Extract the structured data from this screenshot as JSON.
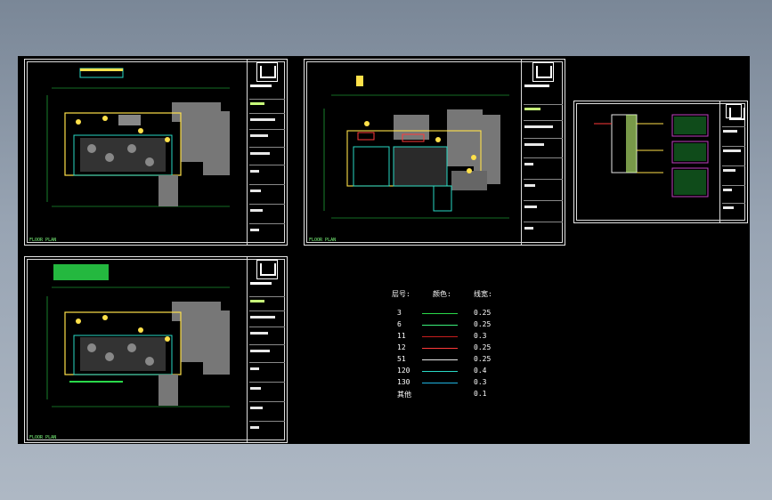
{
  "sheets": [
    {
      "id": "a",
      "label": "FLOOR PLAN"
    },
    {
      "id": "b",
      "label": "FLOOR PLAN"
    },
    {
      "id": "c",
      "label": ""
    },
    {
      "id": "d",
      "label": "FLOOR PLAN"
    }
  ],
  "legend": {
    "headers": {
      "layer": "层号:",
      "color": "颜色:",
      "width": "线宽:"
    },
    "rows": [
      {
        "layer": "3",
        "color": "#2ad84a",
        "width": "0.25"
      },
      {
        "layer": "6",
        "color": "#3af07a",
        "width": "0.25"
      },
      {
        "layer": "11",
        "color": "#c81e1e",
        "width": "0.3"
      },
      {
        "layer": "12",
        "color": "#ff3a3a",
        "width": "0.25"
      },
      {
        "layer": "51",
        "color": "#e8e8e8",
        "width": "0.25"
      },
      {
        "layer": "120",
        "color": "#29d9c5",
        "width": "0.4"
      },
      {
        "layer": "130",
        "color": "#1fb4e0",
        "width": "0.3"
      },
      {
        "layer": "其他",
        "color": "#000000",
        "width": "0.1"
      }
    ]
  }
}
